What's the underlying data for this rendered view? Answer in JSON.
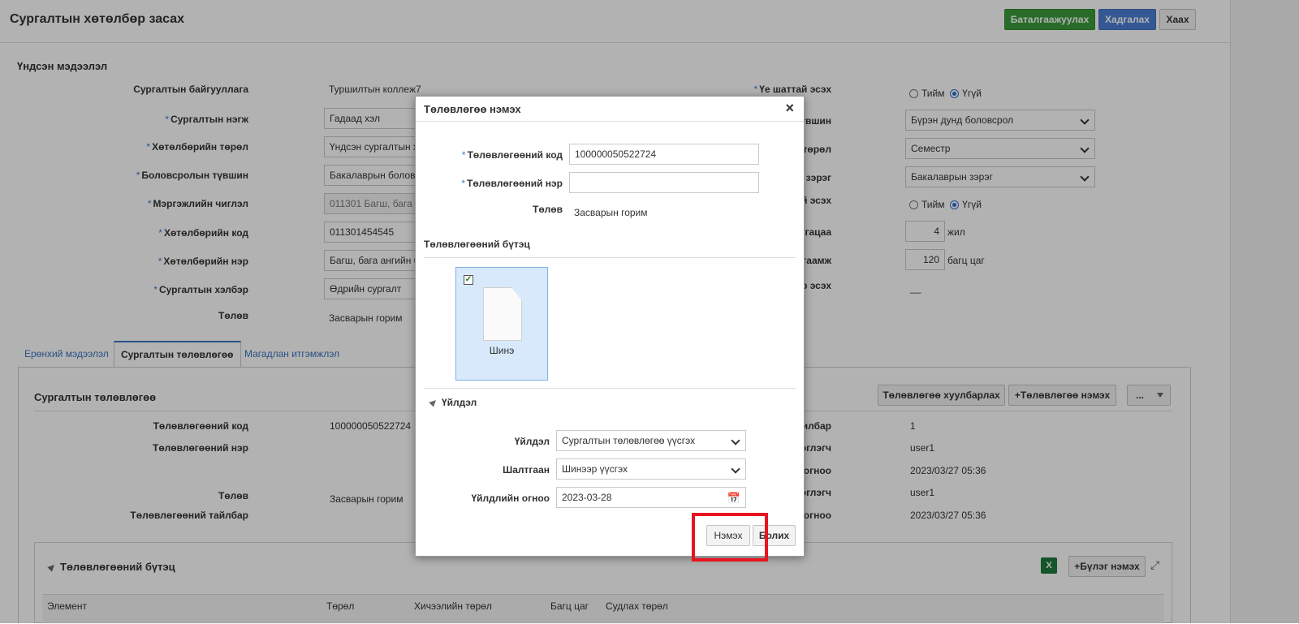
{
  "header": {
    "title": "Сургалтын хөтөлбөр засах",
    "confirm_label": "Баталгаажуулах",
    "save_label": "Хадгалах",
    "close_label": "Хаах"
  },
  "basic_info": {
    "heading": "Үндсэн мэдээлэл",
    "left": [
      {
        "label": "Сургалтын байгууллага",
        "value": "Туршилтын коллеж7",
        "required": false
      },
      {
        "label": "Сургалтын нэгж",
        "value": "Гадаад хэл",
        "required": true
      },
      {
        "label": "Хөтөлбөрийн төрөл",
        "value": "Үндсэн сургалтын х",
        "required": true
      },
      {
        "label": "Боловсролын түвшин",
        "value": "Бакалаврын боловс",
        "required": true
      },
      {
        "label": "Мэргэжлийн чиглэл",
        "value": "011301 Багш, бага а",
        "required": true
      },
      {
        "label": "Хөтөлбөрийн код",
        "value": "011301454545",
        "required": true
      },
      {
        "label": "Хөтөлбөрийн нэр",
        "value": "Багш, бага ангийн б",
        "required": true
      },
      {
        "label": "Сургалтын хэлбэр",
        "value": "Өдрийн сургалт",
        "required": true
      },
      {
        "label": "Төлөв",
        "value": "Засварын горим",
        "required": false
      }
    ],
    "right": [
      {
        "label": "Үе шаттай эсэх",
        "yes": "Тийм",
        "no": "Үгүй"
      },
      {
        "label": "боловсролын түвшин",
        "value": "Бүрэн дунд боловсрол"
      },
      {
        "label": "Улирлын төрөл",
        "value": "Семестр"
      },
      {
        "label": "Боловсролын зэрэг",
        "value": "Бакалаврын зэрэг"
      },
      {
        "label": "аны хязгаартай эсэх",
        "yes": "Тийм",
        "no": "Үгүй"
      },
      {
        "label": "Сургалтын хугацаа",
        "value": "4",
        "unit": "жил"
      },
      {
        "label": "Агуулгын багтаамж",
        "value": "120",
        "unit": "багц цаг"
      },
      {
        "label": "птгэл хөтөлбөр эсэх",
        "value": "__"
      }
    ]
  },
  "tabs": [
    "Ерөнхий мэдээлэл",
    "Сургалтын төлөвлөгөө",
    "Магадлан итгэмжлэл"
  ],
  "plan": {
    "heading": "Сургалтын төлөвлөгөө",
    "copy_label": "Төлөвлөгөө хуулбарлах",
    "add_label": "+Төлөвлөгөө нэмэх",
    "more_label": "...",
    "left": [
      {
        "label": "Төлөвлөгөөний код",
        "value": "100000050522724"
      },
      {
        "label": "Төлөвлөгөөний нэр",
        "value": ""
      },
      {
        "label": "Төлөв",
        "value": "Засварын горим"
      },
      {
        "label": "Төлөвлөгөөний тайлбар",
        "value": ""
      }
    ],
    "right": [
      {
        "label": "рчлөлтийн хувилбар",
        "value": "1"
      },
      {
        "label": "лт хийсэн хэрэглэгч",
        "value": "user1"
      },
      {
        "label": "рчлөлт хийсэн огноо",
        "value": "2023/03/27 05:36"
      },
      {
        "label": "Үүсгэсэн хэрэглэгч",
        "value": "user1"
      },
      {
        "label": "Үүссэн огноо",
        "value": "2023/03/27 05:36"
      }
    ],
    "structure_heading": "Төлөвлөгөөний бүтэц",
    "excel_label": "X",
    "add_group_label": "+Бүлэг нэмэх",
    "columns": [
      "Элемент",
      "Төрөл",
      "Хичээлийн төрөл",
      "Багц цаг",
      "Судлах төрөл"
    ]
  },
  "dialog": {
    "title": "Төлөвлөгөө нэмэх",
    "close": "×",
    "code_label": "Төлөвлөгөөний код",
    "code_value": "100000050522724",
    "name_label": "Төлөвлөгөөний нэр",
    "name_value": "",
    "status_label": "Төлөв",
    "status_value": "Засварын горим",
    "structure_heading": "Төлөвлөгөөний бүтэц",
    "tile_label": "Шинэ",
    "action_heading": "Үйлдэл",
    "action_label": "Үйлдэл",
    "action_value": "Сургалтын төлөвлөгөө үүсгэх",
    "reason_label": "Шалтгаан",
    "reason_value": "Шинээр үүсгэх",
    "date_label": "Үйлдлийн огноо",
    "date_value": "2023-03-28",
    "add_label": "Нэмэх",
    "cancel_label": "Болих"
  }
}
